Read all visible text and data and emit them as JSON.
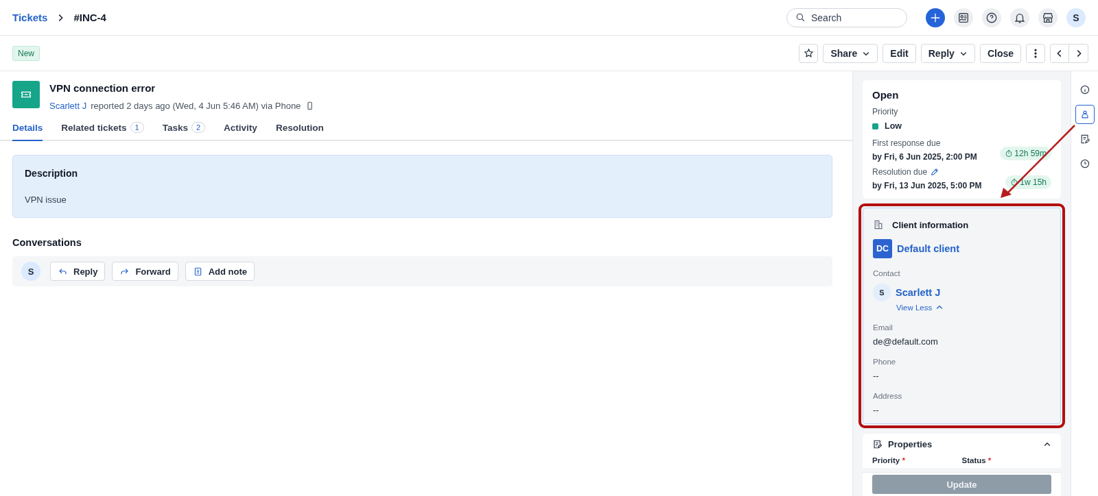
{
  "breadcrumb": {
    "parent": "Tickets",
    "current": "#INC-4"
  },
  "header": {
    "search_placeholder": "Search",
    "avatar": "S"
  },
  "toolbar": {
    "status_badge": "New",
    "buttons": [
      {
        "label": "Share",
        "kind": "dropdown"
      },
      {
        "label": "Edit",
        "kind": "plain"
      },
      {
        "label": "Reply",
        "kind": "dropdown"
      },
      {
        "label": "Close",
        "kind": "plain"
      }
    ]
  },
  "ticket": {
    "title": "VPN connection error",
    "requester": "Scarlett J",
    "meta": "reported 2 days ago (Wed, 4 Jun 5:46 AM) via Phone"
  },
  "tabs": [
    {
      "label": "Details",
      "selected": true
    },
    {
      "label": "Related tickets",
      "count": "1",
      "selected": false
    },
    {
      "label": "Tasks",
      "count": "2",
      "selected": false
    },
    {
      "label": "Activity",
      "selected": false
    },
    {
      "label": "Resolution",
      "selected": false
    }
  ],
  "description": {
    "heading": "Description",
    "text": "VPN issue"
  },
  "conversations": {
    "heading": "Conversations",
    "avatar": "S",
    "actions": [
      {
        "label": "Reply",
        "kind": "reply"
      },
      {
        "label": "Forward",
        "kind": "forward"
      },
      {
        "label": "Add note",
        "kind": "note"
      }
    ]
  },
  "status_card": {
    "status": "Open",
    "priority_label": "Priority",
    "priority": {
      "label": "Low",
      "color": "#17a589"
    },
    "slas": [
      {
        "label": "First response due",
        "due": "by Fri, 6 Jun 2025, 2:00 PM",
        "timer": "12h 59m",
        "editable": false
      },
      {
        "label": "Resolution due",
        "due": "by Fri, 13 Jun 2025, 5:00 PM",
        "timer": "1w 15h",
        "editable": true
      }
    ]
  },
  "client_card": {
    "heading": "Client information",
    "client_initials": "DC",
    "client_name": "Default client",
    "contact_label": "Contact",
    "contact_initial": "S",
    "contact_name": "Scarlett J",
    "toggle": "View Less",
    "expanded": true,
    "fields": [
      {
        "label": "Email",
        "value": "de@default.com"
      },
      {
        "label": "Phone",
        "value": "--"
      },
      {
        "label": "Address",
        "value": "--"
      }
    ]
  },
  "properties": {
    "heading": "Properties",
    "expanded": true,
    "required_mark": "*",
    "fields": [
      {
        "label": "Priority",
        "required": true
      },
      {
        "label": "Status",
        "required": true
      }
    ],
    "update_button": {
      "label": "Update",
      "disabled": true
    }
  },
  "rail": [
    {
      "kind": "info",
      "selected": false
    },
    {
      "kind": "contact",
      "selected": true
    },
    {
      "kind": "notes",
      "selected": false
    },
    {
      "kind": "history",
      "selected": false
    }
  ]
}
